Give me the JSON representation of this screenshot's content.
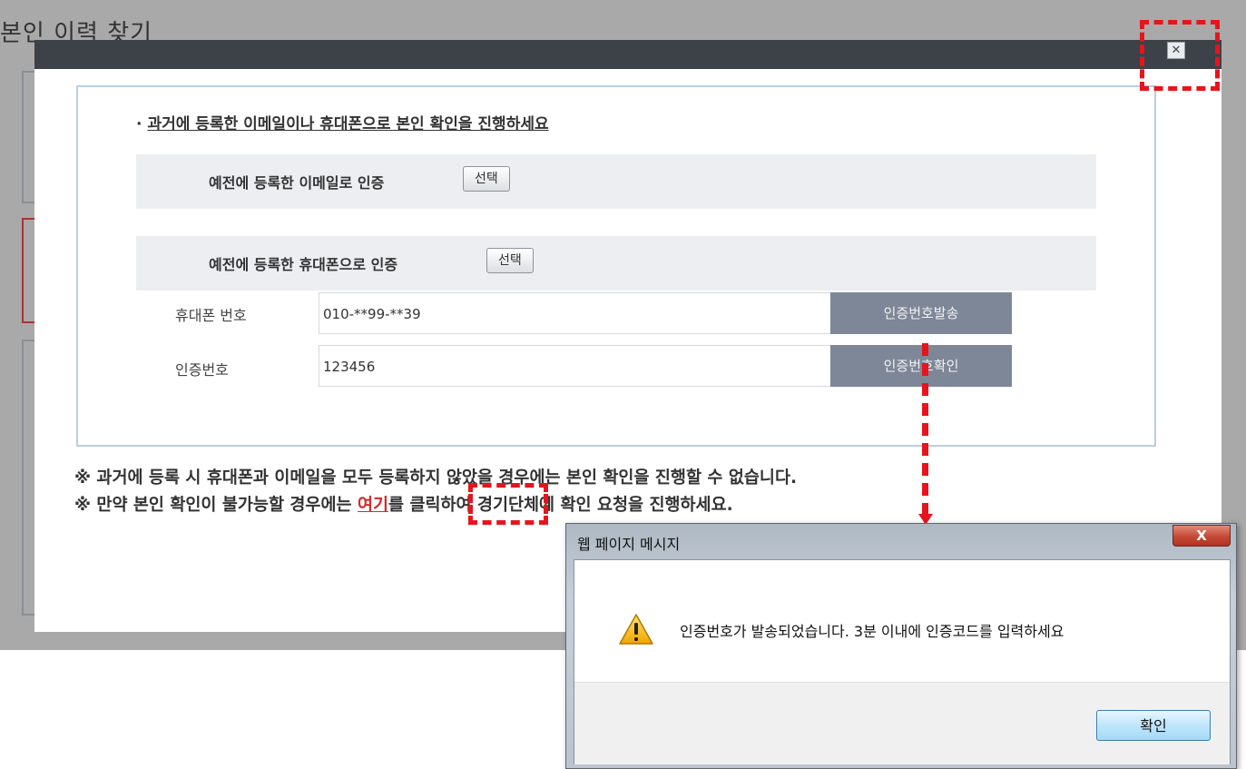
{
  "background": {
    "title": "본인 이력 찾기"
  },
  "modal": {
    "close_glyph": "✕",
    "notice": {
      "bullet": "·",
      "text": "과거에 등록한 이메일이나 휴대폰으로 본인 확인을 진행하세요"
    },
    "email_option": {
      "label": "예전에 등록한 이메일로 인증",
      "button": "선택"
    },
    "phone_option": {
      "label": "예전에 등록한 휴대폰으로 인증",
      "button": "선택"
    },
    "phone_field": {
      "label": "휴대폰 번호",
      "value": "010-**99-**39",
      "action": "인증번호발송"
    },
    "code_field": {
      "label": "인증번호",
      "value": "123456",
      "action": "인증번호확인"
    },
    "notes": {
      "line1": "※ 과거에 등록 시 휴대폰과 이메일을 모두 등록하지 않았을 경우에는 본인 확인을 진행할 수 없습니다.",
      "line2_before": "※ 만약 본인 확인이 불가능할 경우에는 ",
      "line2_link": "여기",
      "line2_after": "를 클릭하여 경기단체에 확인 요청을 진행하세요."
    }
  },
  "dialog": {
    "title": "웹 페이지 메시지",
    "close_glyph": "X",
    "icon": "warning-icon",
    "message": "인증번호가 발송되었습니다. 3분 이내에 인증코드를 입력하세요",
    "ok_label": "확인"
  },
  "colors": {
    "annotation": "#e8141d",
    "modal_header": "#3d4148",
    "action_button": "#7e8797",
    "link": "#d82a2a"
  }
}
